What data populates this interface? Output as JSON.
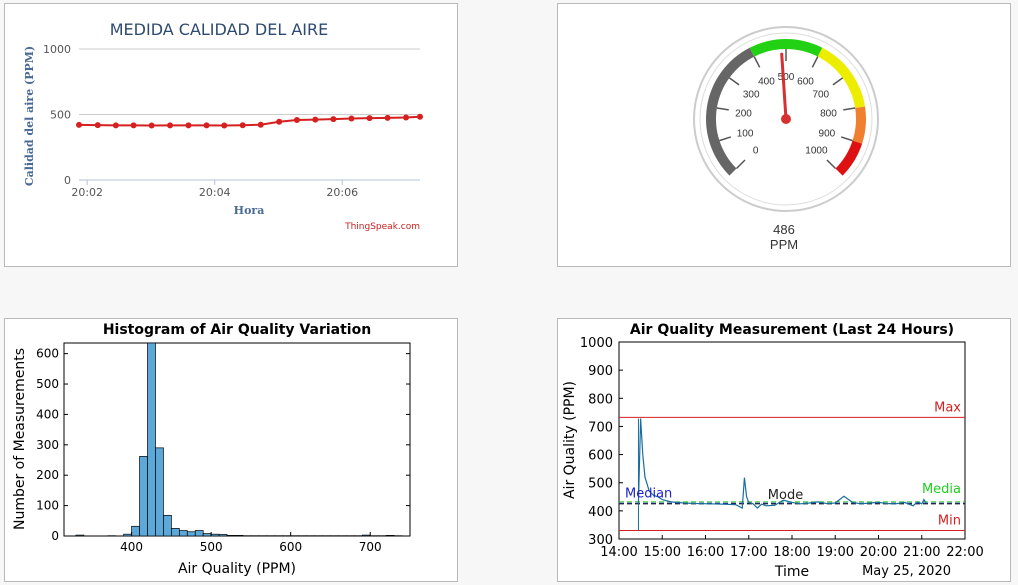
{
  "chart_data": [
    {
      "type": "line",
      "title": "MEDIDA CALIDAD DEL AIRE",
      "xlabel": "Hora",
      "ylabel": "Calidad del aire (PPM)",
      "credit": "ThingSpeak.com",
      "yticks": [
        "0",
        "500",
        "1000"
      ],
      "ylim": [
        0,
        1000
      ],
      "xticks": [
        "20:02",
        "20:04",
        "20:06"
      ],
      "xlim": [
        0,
        100
      ],
      "xtick_pos": [
        2.4,
        39.8,
        77.2
      ],
      "x": [
        0,
        5.5,
        10.8,
        16.0,
        21.3,
        26.7,
        32.1,
        37.4,
        42.6,
        48.0,
        53.3,
        58.7,
        63.9,
        69.3,
        74.6,
        79.9,
        85.2,
        90.5,
        95.9
      ],
      "values": [
        421,
        419,
        417,
        417,
        416,
        417,
        417,
        417,
        416,
        418,
        422,
        445,
        458,
        461,
        465,
        469,
        472,
        474,
        477,
        483
      ],
      "color": "#d62020"
    },
    {
      "type": "gauge",
      "value": 486,
      "value_label": "486",
      "unit": "PPM",
      "min": 0,
      "max": 1000,
      "tick_labels": [
        "0",
        "100",
        "200",
        "300",
        "400",
        "500",
        "600",
        "700",
        "800",
        "900",
        "1000"
      ],
      "bands": [
        {
          "from": 0,
          "to": 400,
          "color": "#666666"
        },
        {
          "from": 400,
          "to": 600,
          "color": "#22d114"
        },
        {
          "from": 600,
          "to": 800,
          "color": "#eded00"
        },
        {
          "from": 800,
          "to": 900,
          "color": "#f08030"
        },
        {
          "from": 900,
          "to": 1000,
          "color": "#dd1111"
        }
      ]
    },
    {
      "type": "bar",
      "title": "Histogram of Air Quality Variation",
      "xlabel": "Air Quality (PPM)",
      "ylabel": "Number of Measurements",
      "xticks": [
        "400",
        "500",
        "600",
        "700"
      ],
      "xtick_vals": [
        400,
        500,
        600,
        700
      ],
      "yticks": [
        "0",
        "100",
        "200",
        "300",
        "400",
        "500",
        "600"
      ],
      "xlim": [
        315,
        750
      ],
      "ylim": [
        0,
        635
      ],
      "bin_width": 10,
      "bin_starts": [
        330,
        370,
        390,
        400,
        410,
        420,
        430,
        440,
        450,
        460,
        470,
        480,
        490,
        500,
        510,
        520,
        530,
        540,
        550,
        560,
        570,
        580,
        590,
        600,
        610,
        620,
        630,
        640,
        650,
        660,
        670,
        680,
        690,
        700,
        710,
        720,
        730
      ],
      "values": [
        3,
        1,
        6,
        32,
        262,
        640,
        290,
        68,
        25,
        18,
        14,
        18,
        8,
        6,
        5,
        2,
        2,
        1,
        1,
        1,
        1,
        1,
        1,
        1,
        1,
        1,
        1,
        1,
        1,
        1,
        1,
        1,
        3,
        1,
        1,
        2,
        1
      ],
      "color": "#5ca8d8"
    },
    {
      "type": "line",
      "title": "Air Quality Measurement (Last 24 Hours)",
      "xlabel": "Time",
      "date_label": "May 25, 2020",
      "ylabel": "Air Quality (PPM)",
      "yticks": [
        "300",
        "400",
        "500",
        "600",
        "700",
        "800",
        "900",
        "1000"
      ],
      "xticks": [
        "14:00",
        "15:00",
        "16:00",
        "17:00",
        "18:00",
        "19:00",
        "20:00",
        "21:00",
        "22:00"
      ],
      "ylim": [
        300,
        1000
      ],
      "xlim": [
        14,
        22
      ],
      "x": [
        14.45,
        14.5,
        14.55,
        14.6,
        14.7,
        14.8,
        14.9,
        15.0,
        15.2,
        15.5,
        15.8,
        16.1,
        16.4,
        16.7,
        16.85,
        16.9,
        16.95,
        17.0,
        17.1,
        17.2,
        17.3,
        17.4,
        17.6,
        17.8,
        18.0,
        18.2,
        18.4,
        18.6,
        18.8,
        19.0,
        19.2,
        19.4,
        19.6,
        19.8,
        20.0,
        20.2,
        20.4,
        20.6,
        20.8,
        20.9,
        21.0,
        21.05,
        21.1
      ],
      "values": [
        430,
        728,
        600,
        520,
        470,
        455,
        450,
        440,
        432,
        428,
        426,
        425,
        424,
        422,
        410,
        518,
        450,
        430,
        425,
        410,
        424,
        418,
        420,
        438,
        430,
        425,
        428,
        432,
        426,
        428,
        452,
        430,
        425,
        428,
        430,
        426,
        425,
        430,
        418,
        432,
        425,
        440,
        428
      ],
      "series_color": "#1a6e9c",
      "max": {
        "label": "Max",
        "value": 732,
        "color": "#d42020"
      },
      "min": {
        "label": "Min",
        "value": 330,
        "color": "#d42020"
      },
      "median": {
        "label": "Median",
        "value": 427,
        "color": "#2222cc"
      },
      "mode": {
        "label": "Mode",
        "value": 425,
        "color": "#222222"
      },
      "media": {
        "label": "Media",
        "value": 432,
        "color": "#22cc22"
      }
    }
  ]
}
